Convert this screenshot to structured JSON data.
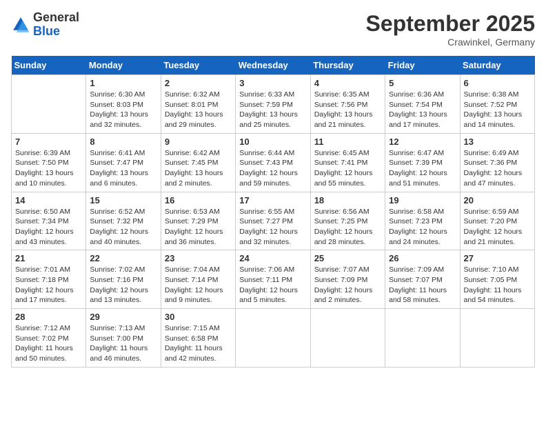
{
  "header": {
    "logo": {
      "general": "General",
      "blue": "Blue"
    },
    "title": "September 2025",
    "subtitle": "Crawinkel, Germany"
  },
  "weekdays": [
    "Sunday",
    "Monday",
    "Tuesday",
    "Wednesday",
    "Thursday",
    "Friday",
    "Saturday"
  ],
  "weeks": [
    [
      null,
      {
        "day": 1,
        "sunrise": "6:30 AM",
        "sunset": "8:03 PM",
        "daylight": "13 hours and 32 minutes."
      },
      {
        "day": 2,
        "sunrise": "6:32 AM",
        "sunset": "8:01 PM",
        "daylight": "13 hours and 29 minutes."
      },
      {
        "day": 3,
        "sunrise": "6:33 AM",
        "sunset": "7:59 PM",
        "daylight": "13 hours and 25 minutes."
      },
      {
        "day": 4,
        "sunrise": "6:35 AM",
        "sunset": "7:56 PM",
        "daylight": "13 hours and 21 minutes."
      },
      {
        "day": 5,
        "sunrise": "6:36 AM",
        "sunset": "7:54 PM",
        "daylight": "13 hours and 17 minutes."
      },
      {
        "day": 6,
        "sunrise": "6:38 AM",
        "sunset": "7:52 PM",
        "daylight": "13 hours and 14 minutes."
      }
    ],
    [
      {
        "day": 7,
        "sunrise": "6:39 AM",
        "sunset": "7:50 PM",
        "daylight": "13 hours and 10 minutes."
      },
      {
        "day": 8,
        "sunrise": "6:41 AM",
        "sunset": "7:47 PM",
        "daylight": "13 hours and 6 minutes."
      },
      {
        "day": 9,
        "sunrise": "6:42 AM",
        "sunset": "7:45 PM",
        "daylight": "13 hours and 2 minutes."
      },
      {
        "day": 10,
        "sunrise": "6:44 AM",
        "sunset": "7:43 PM",
        "daylight": "12 hours and 59 minutes."
      },
      {
        "day": 11,
        "sunrise": "6:45 AM",
        "sunset": "7:41 PM",
        "daylight": "12 hours and 55 minutes."
      },
      {
        "day": 12,
        "sunrise": "6:47 AM",
        "sunset": "7:39 PM",
        "daylight": "12 hours and 51 minutes."
      },
      {
        "day": 13,
        "sunrise": "6:49 AM",
        "sunset": "7:36 PM",
        "daylight": "12 hours and 47 minutes."
      }
    ],
    [
      {
        "day": 14,
        "sunrise": "6:50 AM",
        "sunset": "7:34 PM",
        "daylight": "12 hours and 43 minutes."
      },
      {
        "day": 15,
        "sunrise": "6:52 AM",
        "sunset": "7:32 PM",
        "daylight": "12 hours and 40 minutes."
      },
      {
        "day": 16,
        "sunrise": "6:53 AM",
        "sunset": "7:29 PM",
        "daylight": "12 hours and 36 minutes."
      },
      {
        "day": 17,
        "sunrise": "6:55 AM",
        "sunset": "7:27 PM",
        "daylight": "12 hours and 32 minutes."
      },
      {
        "day": 18,
        "sunrise": "6:56 AM",
        "sunset": "7:25 PM",
        "daylight": "12 hours and 28 minutes."
      },
      {
        "day": 19,
        "sunrise": "6:58 AM",
        "sunset": "7:23 PM",
        "daylight": "12 hours and 24 minutes."
      },
      {
        "day": 20,
        "sunrise": "6:59 AM",
        "sunset": "7:20 PM",
        "daylight": "12 hours and 21 minutes."
      }
    ],
    [
      {
        "day": 21,
        "sunrise": "7:01 AM",
        "sunset": "7:18 PM",
        "daylight": "12 hours and 17 minutes."
      },
      {
        "day": 22,
        "sunrise": "7:02 AM",
        "sunset": "7:16 PM",
        "daylight": "12 hours and 13 minutes."
      },
      {
        "day": 23,
        "sunrise": "7:04 AM",
        "sunset": "7:14 PM",
        "daylight": "12 hours and 9 minutes."
      },
      {
        "day": 24,
        "sunrise": "7:06 AM",
        "sunset": "7:11 PM",
        "daylight": "12 hours and 5 minutes."
      },
      {
        "day": 25,
        "sunrise": "7:07 AM",
        "sunset": "7:09 PM",
        "daylight": "12 hours and 2 minutes."
      },
      {
        "day": 26,
        "sunrise": "7:09 AM",
        "sunset": "7:07 PM",
        "daylight": "11 hours and 58 minutes."
      },
      {
        "day": 27,
        "sunrise": "7:10 AM",
        "sunset": "7:05 PM",
        "daylight": "11 hours and 54 minutes."
      }
    ],
    [
      {
        "day": 28,
        "sunrise": "7:12 AM",
        "sunset": "7:02 PM",
        "daylight": "11 hours and 50 minutes."
      },
      {
        "day": 29,
        "sunrise": "7:13 AM",
        "sunset": "7:00 PM",
        "daylight": "11 hours and 46 minutes."
      },
      {
        "day": 30,
        "sunrise": "7:15 AM",
        "sunset": "6:58 PM",
        "daylight": "11 hours and 42 minutes."
      },
      null,
      null,
      null,
      null
    ]
  ]
}
